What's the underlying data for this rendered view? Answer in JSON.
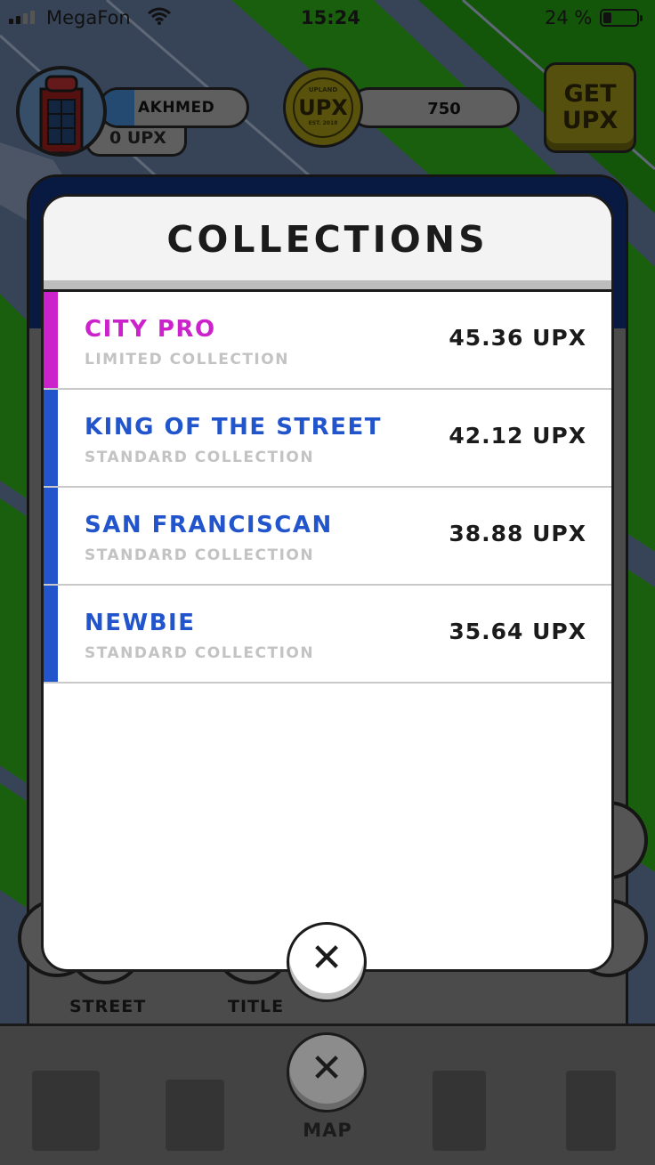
{
  "status_bar": {
    "carrier": "MegaFon",
    "time": "15:24",
    "battery": "24 %"
  },
  "hud": {
    "username": "AKHMED",
    "upx_partial": "0 UPX",
    "balance": "750",
    "coin_top": "UPLAND",
    "coin_big": "UPX",
    "coin_bottom": "EST. 2018",
    "get_upx_line1": "GET",
    "get_upx_line2": "UPX"
  },
  "background": {
    "street_label": "STREET",
    "title_label": "TITLE",
    "map_label": "MAP"
  },
  "modal": {
    "title": "COLLECTIONS",
    "close_glyph": "✕",
    "collections": [
      {
        "name": "CITY PRO",
        "type": "LIMITED COLLECTION",
        "price": "45.36 UPX",
        "color": "#cc22cc"
      },
      {
        "name": "KING OF THE STREET",
        "type": "STANDARD COLLECTION",
        "price": "42.12 UPX",
        "color": "#2255cc"
      },
      {
        "name": "SAN FRANCISCAN",
        "type": "STANDARD COLLECTION",
        "price": "38.88 UPX",
        "color": "#2255cc"
      },
      {
        "name": "NEWBIE",
        "type": "STANDARD COLLECTION",
        "price": "35.64 UPX",
        "color": "#2255cc"
      }
    ]
  },
  "colors": {
    "limited": "#cc22cc",
    "standard": "#2255cc",
    "map_green": "#1f6f10",
    "map_blue": "#4f6585"
  }
}
